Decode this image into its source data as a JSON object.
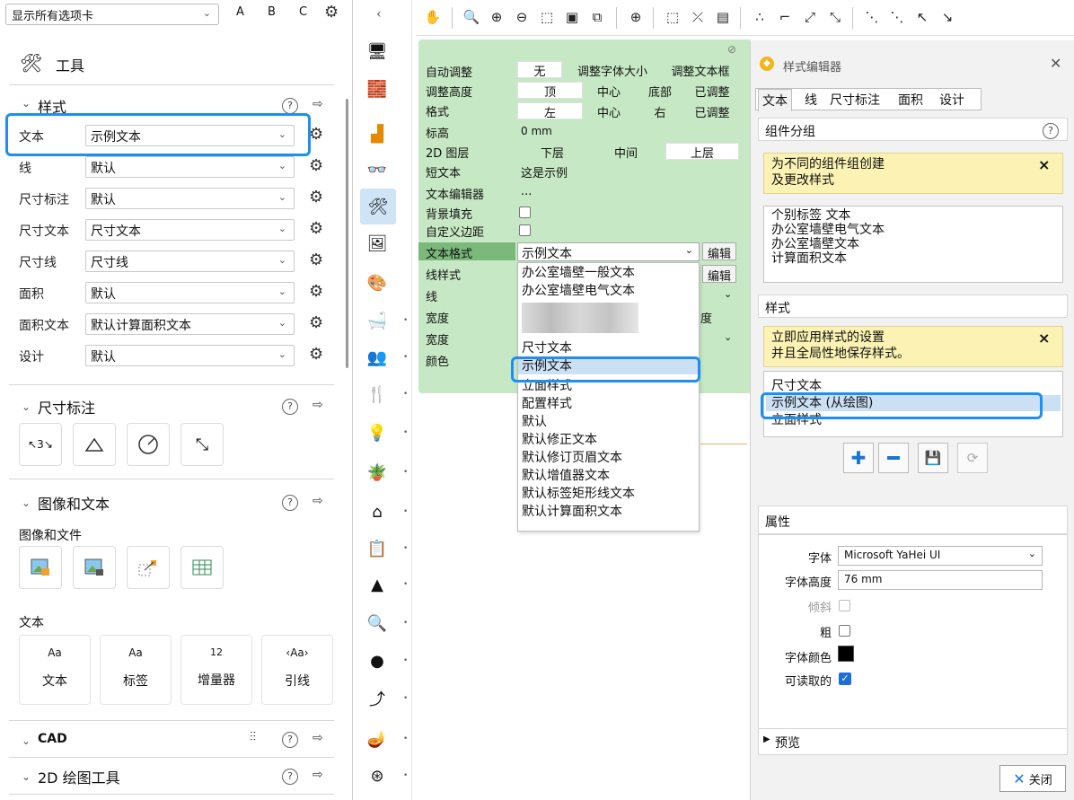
{
  "left_panel": {
    "tab_selector": "显示所有选项卡",
    "letters": [
      "A",
      "B",
      "C"
    ],
    "tools_title": "工具",
    "style_section": {
      "title": "样式",
      "rows": [
        {
          "label": "文本",
          "value": "示例文本"
        },
        {
          "label": "线",
          "value": "默认"
        },
        {
          "label": "尺寸标注",
          "value": "默认"
        },
        {
          "label": "尺寸文本",
          "value": "尺寸文本"
        },
        {
          "label": "尺寸线",
          "value": "尺寸线"
        },
        {
          "label": "面积",
          "value": "默认"
        },
        {
          "label": "面积文本",
          "value": "默认计算面积文本"
        },
        {
          "label": "设计",
          "value": "默认"
        }
      ]
    },
    "dimension_section": {
      "title": "尺寸标注",
      "icon_label": "3"
    },
    "image_text_section": {
      "title": "图像和文本",
      "images_label": "图像和文件",
      "text_label": "文本",
      "text_buttons": [
        {
          "label": "文本",
          "glyph": "Aa"
        },
        {
          "label": "标签",
          "glyph": "Aa"
        },
        {
          "label": "增量器",
          "glyph": "12"
        },
        {
          "label": "引线",
          "glyph": "‹Aa›"
        }
      ]
    },
    "cad_section": {
      "title": "CAD"
    },
    "draw2d_section": {
      "title": "2D 绘图工具"
    }
  },
  "properties": {
    "auto_adjust": {
      "label": "自动调整",
      "options": [
        "无",
        "调整字体大小",
        "调整文本框"
      ]
    },
    "adjust_height": {
      "label": "调整高度",
      "options": [
        "顶",
        "中心",
        "底部",
        "已调整"
      ]
    },
    "format": {
      "label": "格式",
      "options": [
        "左",
        "中心",
        "右",
        "已调整"
      ]
    },
    "elevation": {
      "label": "标高",
      "value": "0 mm"
    },
    "layer2d": {
      "label": "2D 图层",
      "options": [
        "下层",
        "中间",
        "上层"
      ]
    },
    "short_text": {
      "label": "短文本",
      "value": "这是示例"
    },
    "text_editor": {
      "label": "文本编辑器",
      "value": "..."
    },
    "bg_fill": {
      "label": "背景填充"
    },
    "custom_margin": {
      "label": "自定义边距"
    },
    "text_format": {
      "label": "文本格式",
      "value": "示例文本",
      "edit": "编辑"
    },
    "line_style": {
      "label": "线样式",
      "edit": "编辑"
    },
    "line": {
      "label": "线"
    },
    "width1": {
      "label": "宽度",
      "suffix": "度"
    },
    "width2": {
      "label": "宽度"
    },
    "color": {
      "label": "颜色"
    }
  },
  "dropdown_items": [
    "办公室墙壁一般文本",
    "办公室墙壁电气文本",
    "尺寸文本",
    "示例文本",
    "立面样式",
    "配置样式",
    "默认",
    "默认修正文本",
    "默认修订页眉文本",
    "默认增值器文本",
    "默认标签矩形线文本",
    "默认计算面积文本"
  ],
  "dropdown_selected": "示例文本",
  "style_editor": {
    "title": "样式编辑器",
    "tabs": [
      "文本",
      "线",
      "尺寸标注",
      "面积",
      "设计"
    ],
    "group_section": {
      "title": "组件分组",
      "info": [
        "为不同的组件组创建",
        "及更改样式"
      ],
      "items": [
        "个别标签 文本",
        "办公室墙壁电气文本",
        "办公室墙壁文本",
        "计算面积文本"
      ]
    },
    "style_section": {
      "title": "样式",
      "info": [
        "立即应用样式的设置",
        "并且全局性地保存样式。"
      ],
      "items": [
        "尺寸文本",
        "示例文本 (从绘图)",
        "立面样式"
      ]
    },
    "props_title": "属性",
    "font_label": "字体",
    "font_value": "Microsoft YaHei UI",
    "height_label": "字体高度",
    "height_value": "76 mm",
    "italic_label": "倾斜",
    "bold_label": "粗",
    "color_label": "字体颜色",
    "readable_label": "可读取的",
    "preview_label": "预览",
    "close_label": "关闭"
  },
  "colors": {
    "accent": "#1e8ff0",
    "green_panel": "#c6e8c4",
    "yellow_info": "#fbf2b3"
  }
}
